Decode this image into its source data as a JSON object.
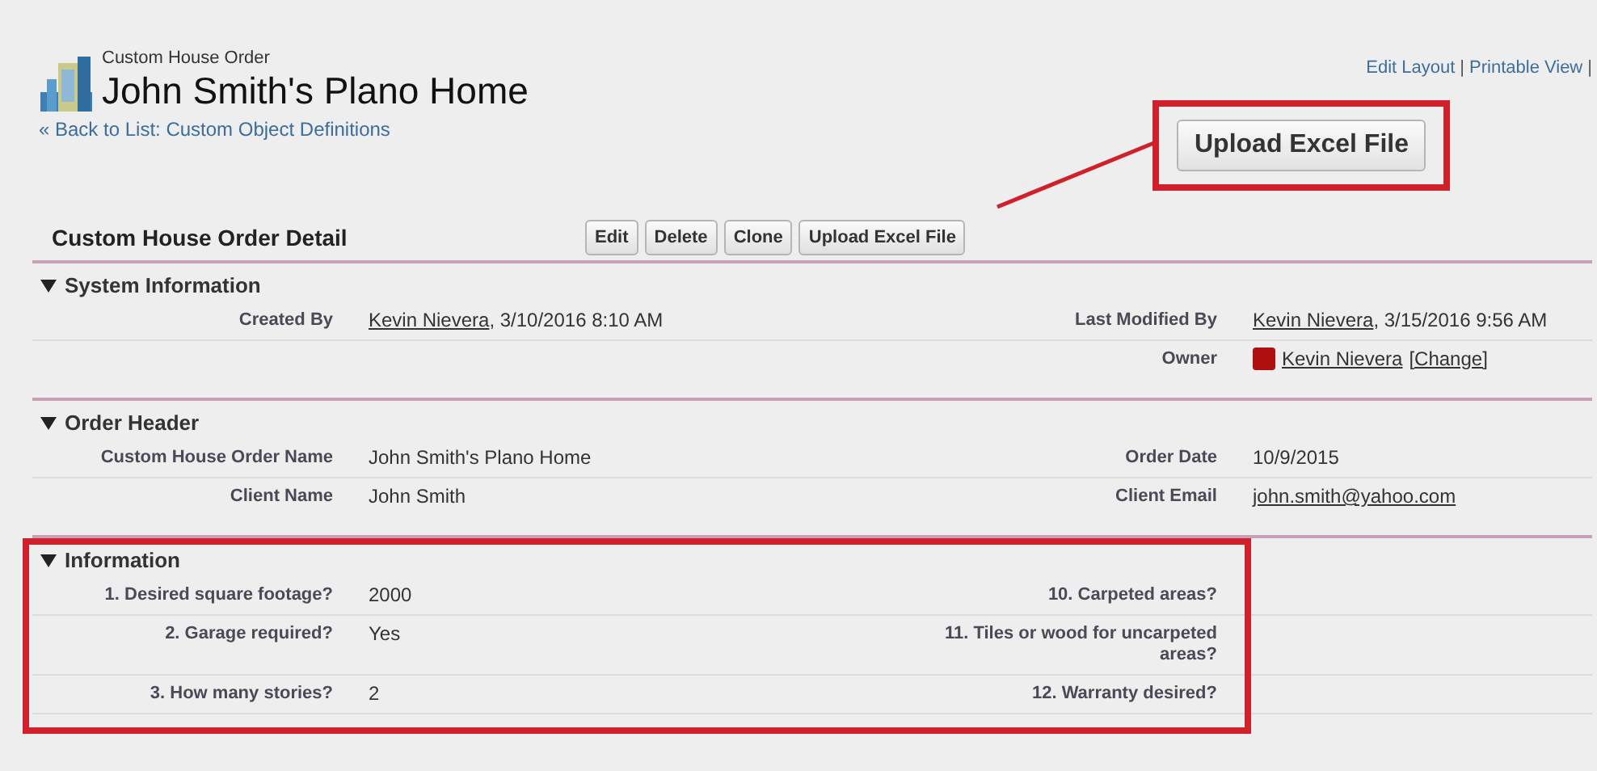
{
  "header": {
    "object_type": "Custom House Order",
    "title": "John Smith's Plano Home",
    "back_link": "« Back to List: Custom Object Definitions",
    "links": [
      {
        "kind": "link",
        "text": "Edit Layout"
      },
      {
        "kind": "separator",
        "text": "|"
      },
      {
        "kind": "link",
        "text": "Printable View"
      },
      {
        "kind": "separator",
        "text": "|"
      }
    ]
  },
  "callout": {
    "button": "Upload Excel File"
  },
  "detail": {
    "title": "Custom House Order Detail",
    "buttons": [
      "Edit",
      "Delete",
      "Clone",
      "Upload Excel File"
    ]
  },
  "sections": [
    {
      "title": "System Information",
      "expanded": true,
      "highlighted": false,
      "rows": [
        {
          "left": {
            "label": "Created By",
            "value": [
              {
                "kind": "link",
                "text": "Kevin Nievera"
              },
              {
                "kind": "text",
                "text": ", 3/10/2016 8:10 AM"
              }
            ]
          },
          "right": {
            "label": "Last Modified By",
            "value": [
              {
                "kind": "link",
                "text": "Kevin Nievera"
              },
              {
                "kind": "text",
                "text": ", 3/15/2016 9:56 AM"
              }
            ]
          }
        },
        {
          "right": {
            "label": "Owner",
            "value": [
              {
                "kind": "avatar"
              },
              {
                "kind": "link",
                "text": "Kevin Nievera"
              },
              {
                "kind": "link",
                "text": "[Change]"
              }
            ]
          }
        }
      ]
    },
    {
      "title": "Order Header",
      "expanded": true,
      "highlighted": false,
      "rows": [
        {
          "left": {
            "label": "Custom House Order Name",
            "value": [
              {
                "kind": "text",
                "text": "John Smith's Plano Home"
              }
            ]
          },
          "right": {
            "label": "Order Date",
            "value": [
              {
                "kind": "text",
                "text": "10/9/2015"
              }
            ]
          }
        },
        {
          "left": {
            "label": "Client Name",
            "value": [
              {
                "kind": "text",
                "text": "John Smith"
              }
            ]
          },
          "right": {
            "label": "Client Email",
            "value": [
              {
                "kind": "link",
                "text": "john.smith@yahoo.com"
              }
            ]
          }
        }
      ]
    },
    {
      "title": "Information",
      "expanded": true,
      "highlighted": true,
      "rows": [
        {
          "left": {
            "label": "1. Desired square footage?",
            "value": [
              {
                "kind": "text",
                "text": "2000"
              }
            ]
          },
          "right": {
            "label": "10. Carpeted areas?"
          }
        },
        {
          "left": {
            "label": "2. Garage required?",
            "value": [
              {
                "kind": "text",
                "text": "Yes"
              }
            ]
          },
          "right": {
            "label": "11. Tiles or wood for uncarpeted areas?"
          }
        },
        {
          "left": {
            "label": "3. How many stories?",
            "value": [
              {
                "kind": "text",
                "text": "2"
              }
            ]
          },
          "right": {
            "label": "12. Warranty desired?"
          }
        }
      ]
    }
  ]
}
